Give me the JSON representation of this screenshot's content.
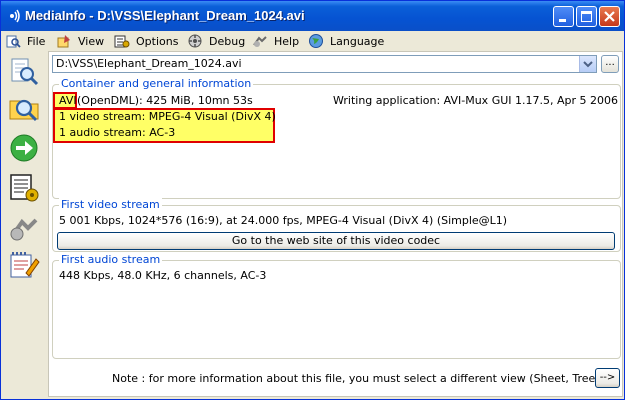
{
  "window": {
    "title": "MediaInfo - D:\\VSS\\Elephant_Dream_1024.avi"
  },
  "menu": {
    "file": "File",
    "view": "View",
    "options": "Options",
    "debug": "Debug",
    "help": "Help",
    "language": "Language"
  },
  "toolbar": {
    "path": "D:\\VSS\\Elephant_Dream_1024.avi",
    "browse_label": "..."
  },
  "container": {
    "legend": "Container and general information",
    "format_hl": "AVI",
    "format_rest": " (OpenDML): 425 MiB, 10mn 53s",
    "writing_app": "Writing application: AVI-Mux GUI 1.17.5, Apr  5 2006",
    "video_summary": "1 video stream: MPEG-4 Visual (DivX 4)",
    "audio_summary": "1 audio stream: AC-3"
  },
  "video": {
    "legend": "First video stream",
    "details": "5 001 Kbps, 1024*576 (16:9), at 24.000 fps, MPEG-4 Visual (DivX 4) (Simple@L1)",
    "codec_button": "Go to the web site of this video codec"
  },
  "audio": {
    "legend": "First audio stream",
    "details": "448 Kbps, 48.0 KHz, 6 channels, AC-3"
  },
  "footer": {
    "note": "Note : for more information about this file, you must select a different view (Sheet, Tree...)",
    "next_button": "-->"
  }
}
